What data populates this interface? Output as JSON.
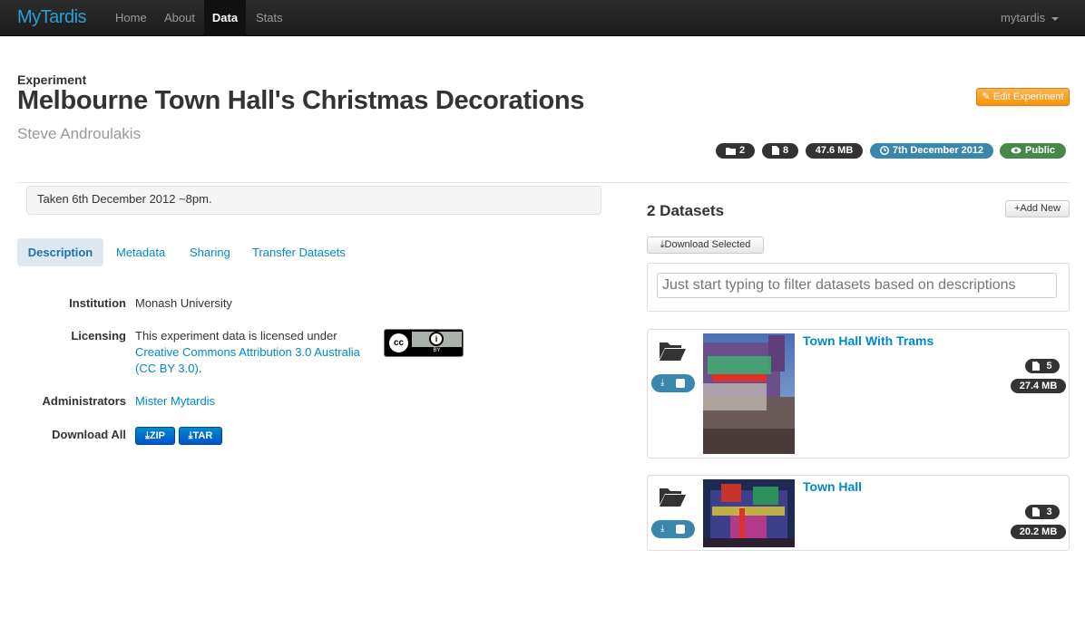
{
  "navbar": {
    "brand": "MyTardis",
    "items": [
      {
        "label": "Home"
      },
      {
        "label": "About"
      },
      {
        "label": "Data"
      },
      {
        "label": "Stats"
      }
    ],
    "user": "mytardis"
  },
  "experiment": {
    "label": "Experiment",
    "title": "Melbourne Town Hall's Christmas Decorations",
    "author": "Steve Androulakis",
    "edit_button": "Edit Experiment",
    "badges": {
      "datasets": "2",
      "files": "8",
      "size": "47.6 MB",
      "date": "7th December 2012",
      "visibility": "Public"
    },
    "description": "Taken 6th December 2012 ~8pm."
  },
  "tabs": [
    {
      "label": "Description"
    },
    {
      "label": "Metadata"
    },
    {
      "label": "Sharing"
    },
    {
      "label": "Transfer Datasets"
    }
  ],
  "details": {
    "institution_label": "Institution",
    "institution": "Monash University",
    "licensing_label": "Licensing",
    "licensing_text": "This experiment data is licensed under",
    "licensing_link": "Creative Commons Attribution 3.0 Australia",
    "licensing_link2": "(CC BY 3.0)",
    "licensing_tail": ".",
    "cc_by": "BY",
    "admins_label": "Administrators",
    "admins": "Mister Mytardis",
    "download_label": "Download All",
    "zip": "ZIP",
    "tar": "TAR"
  },
  "datasets_panel": {
    "title": "2 Datasets",
    "add_new": "Add New",
    "download_selected": "Download Selected",
    "filter_placeholder": "Just start typing to filter datasets based on descriptions",
    "datasets": [
      {
        "name": "Town Hall With Trams",
        "files": "5",
        "size": "27.4 MB"
      },
      {
        "name": "Town Hall",
        "files": "3",
        "size": "20.2 MB"
      }
    ]
  },
  "colors": {
    "brand": "#2a9fd6",
    "link": "#0088cc",
    "warning": "#f89406",
    "info": "#3a87ad",
    "success": "#468847"
  }
}
